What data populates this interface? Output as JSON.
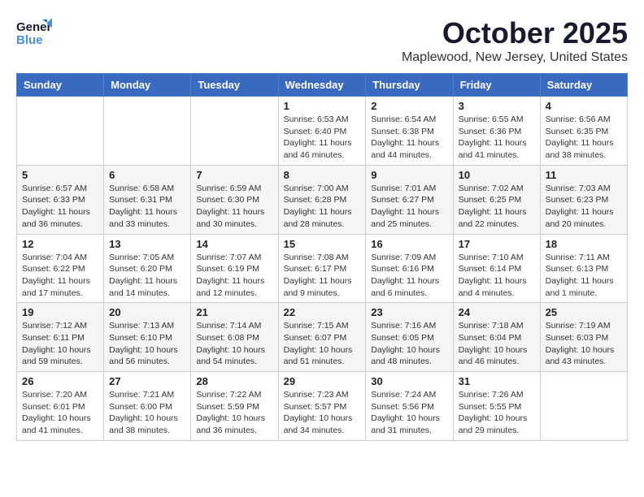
{
  "header": {
    "logo_general": "General",
    "logo_blue": "Blue",
    "month": "October 2025",
    "location": "Maplewood, New Jersey, United States"
  },
  "weekdays": [
    "Sunday",
    "Monday",
    "Tuesday",
    "Wednesday",
    "Thursday",
    "Friday",
    "Saturday"
  ],
  "weeks": [
    [
      {
        "day": "",
        "info": ""
      },
      {
        "day": "",
        "info": ""
      },
      {
        "day": "",
        "info": ""
      },
      {
        "day": "1",
        "info": "Sunrise: 6:53 AM\nSunset: 6:40 PM\nDaylight: 11 hours\nand 46 minutes."
      },
      {
        "day": "2",
        "info": "Sunrise: 6:54 AM\nSunset: 6:38 PM\nDaylight: 11 hours\nand 44 minutes."
      },
      {
        "day": "3",
        "info": "Sunrise: 6:55 AM\nSunset: 6:36 PM\nDaylight: 11 hours\nand 41 minutes."
      },
      {
        "day": "4",
        "info": "Sunrise: 6:56 AM\nSunset: 6:35 PM\nDaylight: 11 hours\nand 38 minutes."
      }
    ],
    [
      {
        "day": "5",
        "info": "Sunrise: 6:57 AM\nSunset: 6:33 PM\nDaylight: 11 hours\nand 36 minutes."
      },
      {
        "day": "6",
        "info": "Sunrise: 6:58 AM\nSunset: 6:31 PM\nDaylight: 11 hours\nand 33 minutes."
      },
      {
        "day": "7",
        "info": "Sunrise: 6:59 AM\nSunset: 6:30 PM\nDaylight: 11 hours\nand 30 minutes."
      },
      {
        "day": "8",
        "info": "Sunrise: 7:00 AM\nSunset: 6:28 PM\nDaylight: 11 hours\nand 28 minutes."
      },
      {
        "day": "9",
        "info": "Sunrise: 7:01 AM\nSunset: 6:27 PM\nDaylight: 11 hours\nand 25 minutes."
      },
      {
        "day": "10",
        "info": "Sunrise: 7:02 AM\nSunset: 6:25 PM\nDaylight: 11 hours\nand 22 minutes."
      },
      {
        "day": "11",
        "info": "Sunrise: 7:03 AM\nSunset: 6:23 PM\nDaylight: 11 hours\nand 20 minutes."
      }
    ],
    [
      {
        "day": "12",
        "info": "Sunrise: 7:04 AM\nSunset: 6:22 PM\nDaylight: 11 hours\nand 17 minutes."
      },
      {
        "day": "13",
        "info": "Sunrise: 7:05 AM\nSunset: 6:20 PM\nDaylight: 11 hours\nand 14 minutes."
      },
      {
        "day": "14",
        "info": "Sunrise: 7:07 AM\nSunset: 6:19 PM\nDaylight: 11 hours\nand 12 minutes."
      },
      {
        "day": "15",
        "info": "Sunrise: 7:08 AM\nSunset: 6:17 PM\nDaylight: 11 hours\nand 9 minutes."
      },
      {
        "day": "16",
        "info": "Sunrise: 7:09 AM\nSunset: 6:16 PM\nDaylight: 11 hours\nand 6 minutes."
      },
      {
        "day": "17",
        "info": "Sunrise: 7:10 AM\nSunset: 6:14 PM\nDaylight: 11 hours\nand 4 minutes."
      },
      {
        "day": "18",
        "info": "Sunrise: 7:11 AM\nSunset: 6:13 PM\nDaylight: 11 hours\nand 1 minute."
      }
    ],
    [
      {
        "day": "19",
        "info": "Sunrise: 7:12 AM\nSunset: 6:11 PM\nDaylight: 10 hours\nand 59 minutes."
      },
      {
        "day": "20",
        "info": "Sunrise: 7:13 AM\nSunset: 6:10 PM\nDaylight: 10 hours\nand 56 minutes."
      },
      {
        "day": "21",
        "info": "Sunrise: 7:14 AM\nSunset: 6:08 PM\nDaylight: 10 hours\nand 54 minutes."
      },
      {
        "day": "22",
        "info": "Sunrise: 7:15 AM\nSunset: 6:07 PM\nDaylight: 10 hours\nand 51 minutes."
      },
      {
        "day": "23",
        "info": "Sunrise: 7:16 AM\nSunset: 6:05 PM\nDaylight: 10 hours\nand 48 minutes."
      },
      {
        "day": "24",
        "info": "Sunrise: 7:18 AM\nSunset: 6:04 PM\nDaylight: 10 hours\nand 46 minutes."
      },
      {
        "day": "25",
        "info": "Sunrise: 7:19 AM\nSunset: 6:03 PM\nDaylight: 10 hours\nand 43 minutes."
      }
    ],
    [
      {
        "day": "26",
        "info": "Sunrise: 7:20 AM\nSunset: 6:01 PM\nDaylight: 10 hours\nand 41 minutes."
      },
      {
        "day": "27",
        "info": "Sunrise: 7:21 AM\nSunset: 6:00 PM\nDaylight: 10 hours\nand 38 minutes."
      },
      {
        "day": "28",
        "info": "Sunrise: 7:22 AM\nSunset: 5:59 PM\nDaylight: 10 hours\nand 36 minutes."
      },
      {
        "day": "29",
        "info": "Sunrise: 7:23 AM\nSunset: 5:57 PM\nDaylight: 10 hours\nand 34 minutes."
      },
      {
        "day": "30",
        "info": "Sunrise: 7:24 AM\nSunset: 5:56 PM\nDaylight: 10 hours\nand 31 minutes."
      },
      {
        "day": "31",
        "info": "Sunrise: 7:26 AM\nSunset: 5:55 PM\nDaylight: 10 hours\nand 29 minutes."
      },
      {
        "day": "",
        "info": ""
      }
    ]
  ]
}
